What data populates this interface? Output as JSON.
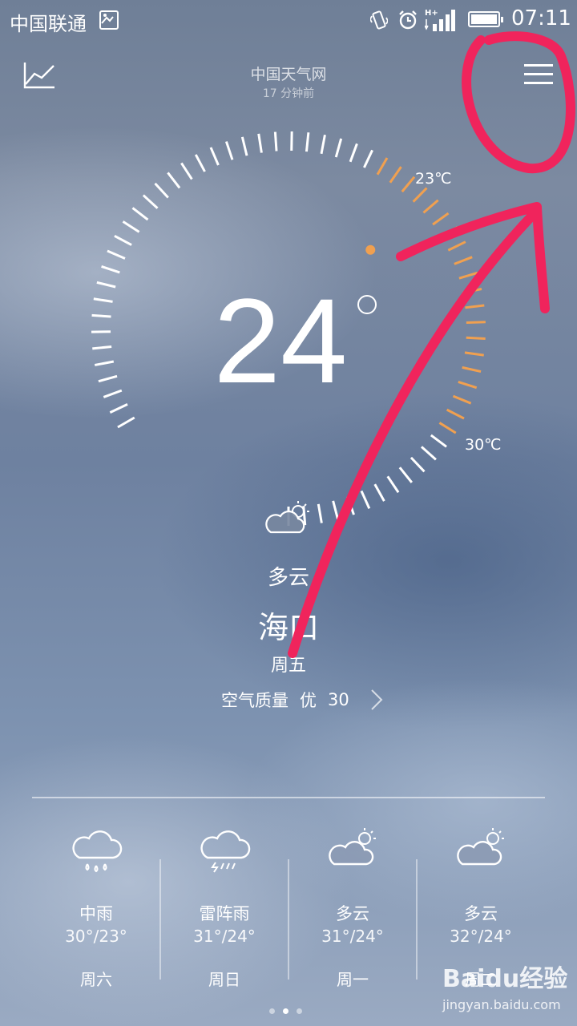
{
  "status_bar": {
    "carrier": "中国联通",
    "time": "07:11"
  },
  "header": {
    "source": "中国天气网",
    "updated": "17 分钟前"
  },
  "current": {
    "temperature": "24",
    "low_label": "23℃",
    "high_label": "30℃",
    "condition": "多云",
    "city": "海口",
    "weekday": "周五",
    "aqi_label": "空气质量",
    "aqi_level": "优",
    "aqi_value": "30"
  },
  "forecast": [
    {
      "condition": "中雨",
      "range": "30°/23°",
      "day": "周六",
      "icon": "moderate-rain-icon"
    },
    {
      "condition": "雷阵雨",
      "range": "31°/24°",
      "day": "周日",
      "icon": "thunderstorm-icon"
    },
    {
      "condition": "多云",
      "range": "31°/24°",
      "day": "周一",
      "icon": "partly-cloudy-icon"
    },
    {
      "condition": "多云",
      "range": "32°/24°",
      "day": "周二",
      "icon": "partly-cloudy-icon"
    }
  ],
  "pager": {
    "count": 3,
    "active": 1
  },
  "watermark": {
    "brand": "Baidu经验",
    "url": "jingyan.baidu.com"
  },
  "colors": {
    "accent_orange": "#f0a050",
    "annotation_red": "#f0245c"
  }
}
